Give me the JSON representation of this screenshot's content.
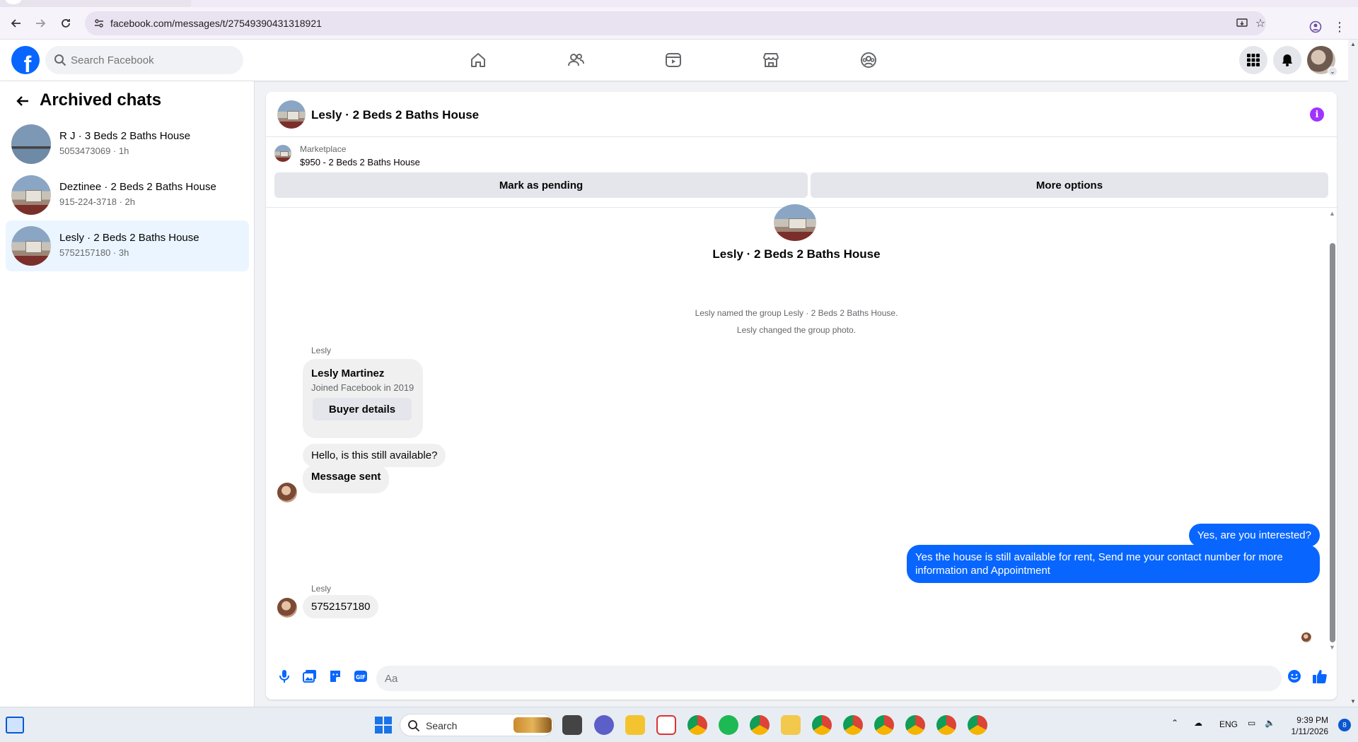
{
  "browser": {
    "url": "facebook.com/messages/t/27549390431318921"
  },
  "header": {
    "search_placeholder": "Search Facebook",
    "logo_letter": "f"
  },
  "sidebar": {
    "title": "Archived chats",
    "chats": [
      {
        "name": "R J · 3 Beds 2 Baths House",
        "sub": "5053473069 · 1h"
      },
      {
        "name": "Deztinee · 2 Beds 2 Baths House",
        "sub": "915-224-3718 · 2h"
      },
      {
        "name": "Lesly · 2 Beds 2 Baths House",
        "sub": "5752157180 · 3h"
      }
    ]
  },
  "conversation": {
    "title": "Lesly · 2 Beds 2 Baths House",
    "marketplace": {
      "label": "Marketplace",
      "item": "$950 - 2 Beds 2 Baths House",
      "pending_button": "Mark as pending",
      "more_button": "More options"
    },
    "thread": {
      "center_name": "Lesly · 2 Beds 2 Baths House",
      "system_messages": [
        "Lesly named the group Lesly · 2 Beds 2 Baths House.",
        "Lesly changed the group photo."
      ],
      "sender_1": "Lesly",
      "card_name": "Lesly Martinez",
      "card_sub": "Joined Facebook in 2019",
      "card_button": "Buyer details",
      "msg_in_1": "Hello, is this still available?",
      "msg_in_2": "Message sent",
      "msg_out_1": "Yes, are you interested?",
      "msg_out_2": "Yes the house is still available for rent, Send me your contact number for more information and Appointment",
      "sender_2": "Lesly",
      "msg_in_3": "5752157180"
    },
    "composer_placeholder": "Aa"
  },
  "taskbar": {
    "search_label": "Search",
    "lang": "ENG",
    "time": "9:39 PM",
    "date": "1/11/2026",
    "notification_count": "8"
  },
  "colors": {
    "brand": "#0866ff",
    "active_row": "#ebf5ff",
    "info_icon": "#a033ff"
  }
}
